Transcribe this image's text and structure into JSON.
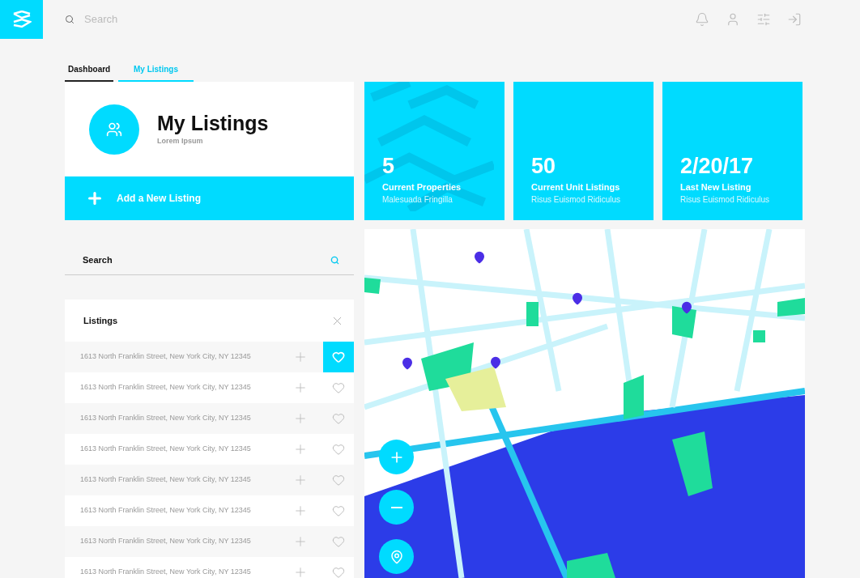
{
  "top_bar": {
    "search": {
      "placeholder": "Search"
    }
  },
  "tabs": [
    {
      "label": "Dashboard",
      "selected": true
    },
    {
      "label": "My Listings",
      "selected": false
    }
  ],
  "header_card": {
    "title": "My Listings",
    "subtitle": "Lorem Ipsum",
    "action": "Add a New Listing"
  },
  "stats": [
    {
      "value": "5",
      "label": "Current Properties",
      "caption": "Malesuada Fringilla",
      "patterned": true
    },
    {
      "value": "50",
      "label": "Current Unit Listings",
      "caption": "Risus Euismod Ridiculus",
      "patterned": false
    },
    {
      "value": "2/20/17",
      "label": "Last New Listing",
      "caption": "Risus Euismod Ridiculus",
      "patterned": false
    }
  ],
  "search": {
    "placeholder": "Search"
  },
  "listings": {
    "title": "Listings",
    "rows": [
      {
        "address": "1613 North Franklin Street, New York City, NY 12345",
        "favorite": true
      },
      {
        "address": "1613 North Franklin Street, New York City, NY 12345",
        "favorite": false
      },
      {
        "address": "1613 North Franklin Street, New York City, NY 12345",
        "favorite": false
      },
      {
        "address": "1613 North Franklin Street, New York City, NY 12345",
        "favorite": false
      },
      {
        "address": "1613 North Franklin Street, New York City, NY 12345",
        "favorite": false
      },
      {
        "address": "1613 North Franklin Street, New York City, NY 12345",
        "favorite": false
      },
      {
        "address": "1613 North Franklin Street, New York City, NY 12345",
        "favorite": false
      },
      {
        "address": "1613 North Franklin Street, New York City, NY 12345",
        "favorite": false
      }
    ]
  }
}
